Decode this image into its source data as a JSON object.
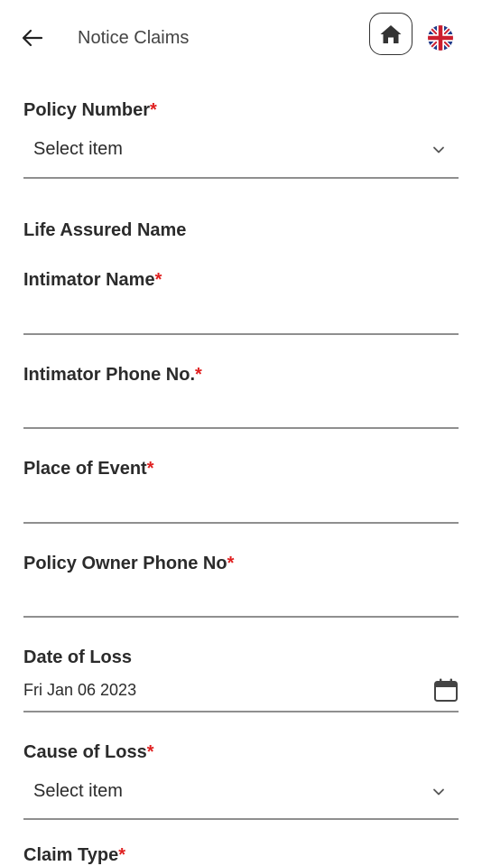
{
  "header": {
    "title": "Notice Claims"
  },
  "form": {
    "policy_number": {
      "label": "Policy Number",
      "required_mark": "*",
      "value": "Select item"
    },
    "life_assured": {
      "label": "Life Assured Name"
    },
    "intimator_name": {
      "label": "Intimator Name",
      "required_mark": "*",
      "value": ""
    },
    "intimator_phone": {
      "label": "Intimator Phone No.",
      "required_mark": "*",
      "value": ""
    },
    "place_of_event": {
      "label": "Place of Event",
      "required_mark": "*",
      "value": ""
    },
    "owner_phone": {
      "label": "Policy Owner Phone No",
      "required_mark": "*",
      "value": ""
    },
    "date_of_loss": {
      "label": "Date of Loss",
      "value": "Fri Jan 06 2023"
    },
    "cause_of_loss": {
      "label": "Cause of Loss",
      "required_mark": "*",
      "value": "Select item"
    },
    "claim_type": {
      "label": "Claim Type",
      "required_mark": "*"
    }
  },
  "icons": {
    "back": "arrow-left-icon",
    "home": "home-icon",
    "language": "uk-flag-icon",
    "dropdown": "chevron-down-icon",
    "calendar": "calendar-icon"
  },
  "colors": {
    "required": "#e02020",
    "underline": "#8f8f8f",
    "text": "#2b2b2b"
  }
}
